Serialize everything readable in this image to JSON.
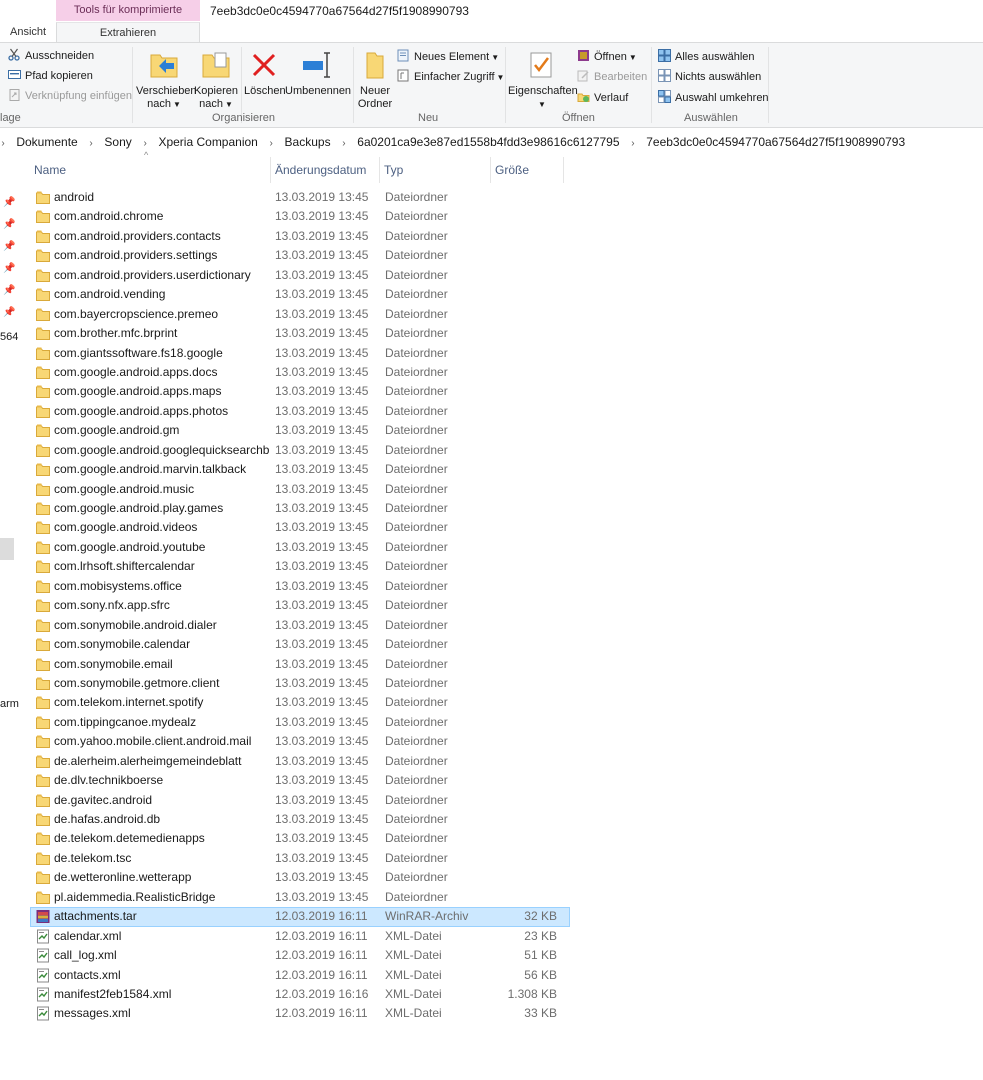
{
  "window": {
    "context_tab": "Tools für komprimierte Ordner",
    "title": "7eeb3dc0e0c4594770a67564d27f5f1908990793"
  },
  "tabs": {
    "ansicht": "Ansicht",
    "extrahieren": "Extrahieren"
  },
  "ribbon": {
    "clipboard": {
      "cut": "Ausschneiden",
      "copy_path": "Pfad kopieren",
      "paste_shortcut": "Verknüpfung einfügen",
      "label": "lage"
    },
    "organize": {
      "move_l1": "Verschieben",
      "move_l2": "nach",
      "copy_l1": "Kopieren",
      "copy_l2": "nach",
      "delete": "Löschen",
      "rename": "Umbenennen",
      "label": "Organisieren"
    },
    "new": {
      "new_folder_l1": "Neuer",
      "new_folder_l2": "Ordner",
      "new_item": "Neues Element",
      "easy_access": "Einfacher Zugriff",
      "label": "Neu"
    },
    "open": {
      "properties": "Eigenschaften",
      "open": "Öffnen",
      "edit": "Bearbeiten",
      "history": "Verlauf",
      "label": "Öffnen"
    },
    "select": {
      "select_all": "Alles auswählen",
      "select_none": "Nichts auswählen",
      "invert": "Auswahl umkehren",
      "label": "Auswählen"
    }
  },
  "breadcrumb": [
    "Dokumente",
    "Sony",
    "Xperia Companion",
    "Backups",
    "6a0201ca9e3e87ed1558b4fdd3e98616c6127795",
    "7eeb3dc0e0c4594770a67564d27f5f1908990793"
  ],
  "nav_fragments": {
    "frag1": "564",
    "frag2": "arm"
  },
  "columns": {
    "name": "Name",
    "date": "Änderungsdatum",
    "type": "Typ",
    "size": "Größe"
  },
  "files": [
    {
      "name": "android",
      "date": "13.03.2019 13:45",
      "type": "Dateiordner",
      "size": "",
      "icon": "folder-icon"
    },
    {
      "name": "com.android.chrome",
      "date": "13.03.2019 13:45",
      "type": "Dateiordner",
      "size": "",
      "icon": "folder-icon"
    },
    {
      "name": "com.android.providers.contacts",
      "date": "13.03.2019 13:45",
      "type": "Dateiordner",
      "size": "",
      "icon": "folder-icon"
    },
    {
      "name": "com.android.providers.settings",
      "date": "13.03.2019 13:45",
      "type": "Dateiordner",
      "size": "",
      "icon": "folder-icon"
    },
    {
      "name": "com.android.providers.userdictionary",
      "date": "13.03.2019 13:45",
      "type": "Dateiordner",
      "size": "",
      "icon": "folder-icon"
    },
    {
      "name": "com.android.vending",
      "date": "13.03.2019 13:45",
      "type": "Dateiordner",
      "size": "",
      "icon": "folder-icon"
    },
    {
      "name": "com.bayercropscience.premeo",
      "date": "13.03.2019 13:45",
      "type": "Dateiordner",
      "size": "",
      "icon": "folder-icon"
    },
    {
      "name": "com.brother.mfc.brprint",
      "date": "13.03.2019 13:45",
      "type": "Dateiordner",
      "size": "",
      "icon": "folder-icon"
    },
    {
      "name": "com.giantssoftware.fs18.google",
      "date": "13.03.2019 13:45",
      "type": "Dateiordner",
      "size": "",
      "icon": "folder-icon"
    },
    {
      "name": "com.google.android.apps.docs",
      "date": "13.03.2019 13:45",
      "type": "Dateiordner",
      "size": "",
      "icon": "folder-icon"
    },
    {
      "name": "com.google.android.apps.maps",
      "date": "13.03.2019 13:45",
      "type": "Dateiordner",
      "size": "",
      "icon": "folder-icon"
    },
    {
      "name": "com.google.android.apps.photos",
      "date": "13.03.2019 13:45",
      "type": "Dateiordner",
      "size": "",
      "icon": "folder-icon"
    },
    {
      "name": "com.google.android.gm",
      "date": "13.03.2019 13:45",
      "type": "Dateiordner",
      "size": "",
      "icon": "folder-icon"
    },
    {
      "name": "com.google.android.googlequicksearchb...",
      "date": "13.03.2019 13:45",
      "type": "Dateiordner",
      "size": "",
      "icon": "folder-icon"
    },
    {
      "name": "com.google.android.marvin.talkback",
      "date": "13.03.2019 13:45",
      "type": "Dateiordner",
      "size": "",
      "icon": "folder-icon"
    },
    {
      "name": "com.google.android.music",
      "date": "13.03.2019 13:45",
      "type": "Dateiordner",
      "size": "",
      "icon": "folder-icon"
    },
    {
      "name": "com.google.android.play.games",
      "date": "13.03.2019 13:45",
      "type": "Dateiordner",
      "size": "",
      "icon": "folder-icon"
    },
    {
      "name": "com.google.android.videos",
      "date": "13.03.2019 13:45",
      "type": "Dateiordner",
      "size": "",
      "icon": "folder-icon"
    },
    {
      "name": "com.google.android.youtube",
      "date": "13.03.2019 13:45",
      "type": "Dateiordner",
      "size": "",
      "icon": "folder-icon"
    },
    {
      "name": "com.lrhsoft.shiftercalendar",
      "date": "13.03.2019 13:45",
      "type": "Dateiordner",
      "size": "",
      "icon": "folder-icon"
    },
    {
      "name": "com.mobisystems.office",
      "date": "13.03.2019 13:45",
      "type": "Dateiordner",
      "size": "",
      "icon": "folder-icon"
    },
    {
      "name": "com.sony.nfx.app.sfrc",
      "date": "13.03.2019 13:45",
      "type": "Dateiordner",
      "size": "",
      "icon": "folder-icon"
    },
    {
      "name": "com.sonymobile.android.dialer",
      "date": "13.03.2019 13:45",
      "type": "Dateiordner",
      "size": "",
      "icon": "folder-icon"
    },
    {
      "name": "com.sonymobile.calendar",
      "date": "13.03.2019 13:45",
      "type": "Dateiordner",
      "size": "",
      "icon": "folder-icon"
    },
    {
      "name": "com.sonymobile.email",
      "date": "13.03.2019 13:45",
      "type": "Dateiordner",
      "size": "",
      "icon": "folder-icon"
    },
    {
      "name": "com.sonymobile.getmore.client",
      "date": "13.03.2019 13:45",
      "type": "Dateiordner",
      "size": "",
      "icon": "folder-icon"
    },
    {
      "name": "com.telekom.internet.spotify",
      "date": "13.03.2019 13:45",
      "type": "Dateiordner",
      "size": "",
      "icon": "folder-icon"
    },
    {
      "name": "com.tippingcanoe.mydealz",
      "date": "13.03.2019 13:45",
      "type": "Dateiordner",
      "size": "",
      "icon": "folder-icon"
    },
    {
      "name": "com.yahoo.mobile.client.android.mail",
      "date": "13.03.2019 13:45",
      "type": "Dateiordner",
      "size": "",
      "icon": "folder-icon"
    },
    {
      "name": "de.alerheim.alerheimgemeindeblatt",
      "date": "13.03.2019 13:45",
      "type": "Dateiordner",
      "size": "",
      "icon": "folder-icon"
    },
    {
      "name": "de.dlv.technikboerse",
      "date": "13.03.2019 13:45",
      "type": "Dateiordner",
      "size": "",
      "icon": "folder-icon"
    },
    {
      "name": "de.gavitec.android",
      "date": "13.03.2019 13:45",
      "type": "Dateiordner",
      "size": "",
      "icon": "folder-icon"
    },
    {
      "name": "de.hafas.android.db",
      "date": "13.03.2019 13:45",
      "type": "Dateiordner",
      "size": "",
      "icon": "folder-icon"
    },
    {
      "name": "de.telekom.detemedienapps",
      "date": "13.03.2019 13:45",
      "type": "Dateiordner",
      "size": "",
      "icon": "folder-icon"
    },
    {
      "name": "de.telekom.tsc",
      "date": "13.03.2019 13:45",
      "type": "Dateiordner",
      "size": "",
      "icon": "folder-icon"
    },
    {
      "name": "de.wetteronline.wetterapp",
      "date": "13.03.2019 13:45",
      "type": "Dateiordner",
      "size": "",
      "icon": "folder-icon"
    },
    {
      "name": "pl.aidemmedia.RealisticBridge",
      "date": "13.03.2019 13:45",
      "type": "Dateiordner",
      "size": "",
      "icon": "folder-icon"
    },
    {
      "name": "attachments.tar",
      "date": "12.03.2019 16:11",
      "type": "WinRAR-Archiv",
      "size": "32 KB",
      "icon": "winrar-archive-icon",
      "selected": true
    },
    {
      "name": "calendar.xml",
      "date": "12.03.2019 16:11",
      "type": "XML-Datei",
      "size": "23 KB",
      "icon": "xml-file-icon"
    },
    {
      "name": "call_log.xml",
      "date": "12.03.2019 16:11",
      "type": "XML-Datei",
      "size": "51 KB",
      "icon": "xml-file-icon"
    },
    {
      "name": "contacts.xml",
      "date": "12.03.2019 16:11",
      "type": "XML-Datei",
      "size": "56 KB",
      "icon": "xml-file-icon"
    },
    {
      "name": "manifest2feb1584.xml",
      "date": "12.03.2019 16:16",
      "type": "XML-Datei",
      "size": "1.308 KB",
      "icon": "xml-file-icon"
    },
    {
      "name": "messages.xml",
      "date": "12.03.2019 16:11",
      "type": "XML-Datei",
      "size": "33 KB",
      "icon": "xml-file-icon"
    }
  ],
  "colors": {
    "context_tab_bg": "#f6cfe8",
    "ribbon_bg": "#f5f6f7",
    "selection_bg": "#cce8ff",
    "folder_yellow": "#f8d775",
    "header_text": "#4d6082"
  }
}
